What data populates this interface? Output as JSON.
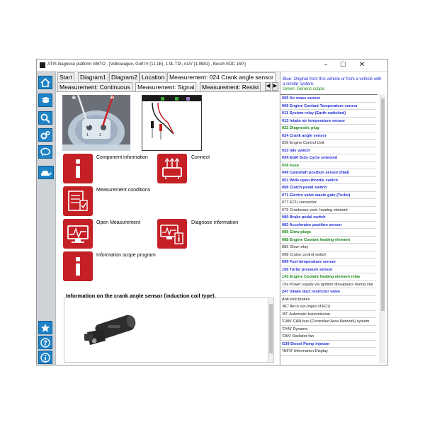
{
  "window": {
    "title": "ATIS diagnose platform GMTO - [Volkswagen, Golf IV (1J,1E), 1.9L TDI, AUV (1.9981) , Bosch EDC 15P.]",
    "minimize": "–",
    "maximize": "☐",
    "close": "✕"
  },
  "sidebar": {
    "items": [
      {
        "name": "home-icon"
      },
      {
        "name": "book-icon"
      },
      {
        "name": "search-icon"
      },
      {
        "name": "gear-icon"
      },
      {
        "name": "chat-icon"
      },
      {
        "name": "car-icon"
      },
      {
        "name": "star-icon"
      },
      {
        "name": "help-icon"
      },
      {
        "name": "info-icon"
      }
    ],
    "accent": "#1e83c7"
  },
  "tabs_row1": [
    "Start",
    "Diagram1",
    "Diagram2",
    "Location",
    "Measurement: 024 Crank angle sensor"
  ],
  "tabs_row2": [
    "Measurement: Continuous",
    "Measurement: Signal",
    "Measurement: Resist"
  ],
  "photo": {
    "label_b": "B",
    "label_r": "R"
  },
  "tiles": {
    "component_information": "Component information",
    "connect": "Connect",
    "measurement_conditions": "Measurement conditions",
    "open_measurement": "Open Measurement",
    "diagnose_information": "Diagnose information",
    "information_scope_program": "Information scope program"
  },
  "info_heading": "Information on the crank angle sensor (induction coil type).",
  "legend": {
    "blue": "Blue: Original from this vehicle or from a vehicle with a similar system.",
    "green": "Green: Generic scope."
  },
  "component_list": [
    {
      "label": "005 Air mass sensor",
      "color": "blue"
    },
    {
      "label": "006 Engine Coolant Temperature sensor",
      "color": "blue"
    },
    {
      "label": "011 System relay (Earth switched)",
      "color": "blue"
    },
    {
      "label": "013 Intake air temperature sensor",
      "color": "blue"
    },
    {
      "label": "022 Diagnostic plug",
      "color": "green"
    },
    {
      "label": "024 Crank angle sensor",
      "color": "blue"
    },
    {
      "label": "026 Engine Control Unit",
      "color": "black"
    },
    {
      "label": "033 Idle switch",
      "color": "blue"
    },
    {
      "label": "034 EGR Duty Cycle solenoid",
      "color": "blue"
    },
    {
      "label": "036 Fuse",
      "color": "green"
    },
    {
      "label": "049 Camshaft position sensor (Hall)",
      "color": "blue"
    },
    {
      "label": "051 Wide open throttle switch",
      "color": "blue"
    },
    {
      "label": "068 Clutch pedal switch",
      "color": "blue"
    },
    {
      "label": "071 Electro valve waste gate (Turbo)",
      "color": "blue"
    },
    {
      "label": "077 ECU connector",
      "color": "black"
    },
    {
      "label": "079 Crankcase vent. heating element",
      "color": "black"
    },
    {
      "label": "080 Brake pedal switch",
      "color": "blue"
    },
    {
      "label": "083 Accelerator position sensor",
      "color": "blue"
    },
    {
      "label": "085 Glow plugs",
      "color": "green"
    },
    {
      "label": "088 Engine Coolant heating element",
      "color": "green"
    },
    {
      "label": "089 Glow relay",
      "color": "black"
    },
    {
      "label": "098 Cruise control switch",
      "color": "black"
    },
    {
      "label": "099 Fuel temperature sensor",
      "color": "blue"
    },
    {
      "label": "106 Turbo pressure sensor",
      "color": "blue"
    },
    {
      "label": "143 Engine Coolant heating element relay",
      "color": "green"
    },
    {
      "label": "15a Power supply via ignition dissapears during star",
      "color": "black"
    },
    {
      "label": "247 Intake duct restrictor valve",
      "color": "blue"
    },
    {
      "label": "Anti lock brakes",
      "color": "black"
    },
    {
      "label": "'AC' Airco out-/input of ECU",
      "color": "black"
    },
    {
      "label": "'AT' Automatic transmission",
      "color": "black"
    },
    {
      "label": "'CAN' CAN-bus (Controlled Area Network) system",
      "color": "black"
    },
    {
      "label": "'DYN' Dynamo",
      "color": "black"
    },
    {
      "label": "'FAN' Radiator fan",
      "color": "black"
    },
    {
      "label": "G39 Diesel Pump injector",
      "color": "blue"
    },
    {
      "label": "'INFO' Information Display",
      "color": "black"
    }
  ],
  "colors": {
    "tile_red": "#c42026",
    "list_blue": "#1f2fd6",
    "list_green": "#188618"
  }
}
